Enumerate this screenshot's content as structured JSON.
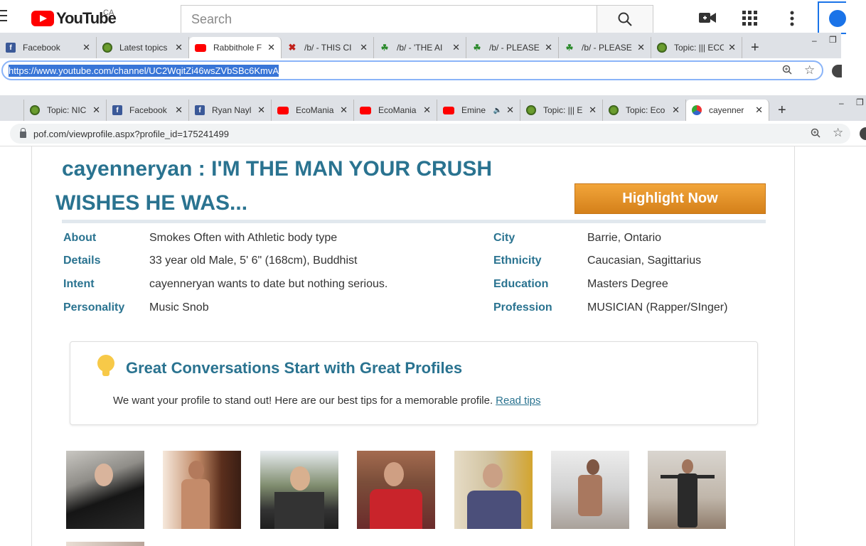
{
  "youtube": {
    "logo_text": "YouTube",
    "region": "CA",
    "search_placeholder": "Search"
  },
  "browser1": {
    "tabs": [
      {
        "label": "Facebook",
        "favicon": "facebook-icon"
      },
      {
        "label": "Latest topics",
        "favicon": "forum-icon"
      },
      {
        "label": "Rabbithole F",
        "favicon": "youtube-icon",
        "active": true
      },
      {
        "label": "/b/ - THIS CI",
        "favicon": "x-icon"
      },
      {
        "label": "/b/ - 'THE AI",
        "favicon": "clover-icon"
      },
      {
        "label": "/b/ - PLEASE",
        "favicon": "clover-icon"
      },
      {
        "label": "/b/ - PLEASE",
        "favicon": "clover-icon"
      },
      {
        "label": "Topic: ||| ECC",
        "favicon": "forum-icon"
      }
    ],
    "url": "https://www.youtube.com/channel/UC2WqitZi46wsZVbSBc6KmvA"
  },
  "browser2": {
    "tabs": [
      {
        "label": "",
        "favicon": "none"
      },
      {
        "label": "Topic: NIC",
        "favicon": "forum-icon"
      },
      {
        "label": "Facebook",
        "favicon": "facebook-icon"
      },
      {
        "label": "Ryan Nayl",
        "favicon": "facebook-icon"
      },
      {
        "label": "EcoMania",
        "favicon": "youtube-icon"
      },
      {
        "label": "EcoMania",
        "favicon": "youtube-icon"
      },
      {
        "label": "Emine",
        "favicon": "youtube-icon",
        "audio": true
      },
      {
        "label": "Topic: ||| E",
        "favicon": "forum-icon"
      },
      {
        "label": "Topic: Eco",
        "favicon": "forum-icon"
      },
      {
        "label": "cayenner",
        "favicon": "pof-icon",
        "active": true
      }
    ],
    "url": "pof.com/viewprofile.aspx?profile_id=175241499"
  },
  "profile": {
    "title_line1": "cayenneryan : I'M THE MAN YOUR CRUSH",
    "title_line2": "WISHES HE WAS...",
    "highlight_button": "Highlight Now",
    "left_details": [
      {
        "label": "About",
        "value": "Smokes Often with Athletic body type"
      },
      {
        "label": "Details",
        "value": "33 year old Male, 5' 6\" (168cm), Buddhist"
      },
      {
        "label": "Intent",
        "value": "cayenneryan wants to date but nothing serious."
      },
      {
        "label": "Personality",
        "value": "Music Snob"
      }
    ],
    "right_details": [
      {
        "label": "City",
        "value": "Barrie, Ontario"
      },
      {
        "label": "Ethnicity",
        "value": "Caucasian, Sagittarius"
      },
      {
        "label": "Education",
        "value": "Masters Degree"
      },
      {
        "label": "Profession",
        "value": "MUSICIAN (Rapper/SInger)"
      }
    ]
  },
  "tips": {
    "heading": "Great Conversations Start with Great Profiles",
    "body": "We want your profile to stand out! Here are our best tips for a memorable profile.",
    "link": "Read tips"
  },
  "colors": {
    "accent": "#2a7390",
    "highlight_button": "#e8961f",
    "youtube_red": "#ff0000"
  }
}
